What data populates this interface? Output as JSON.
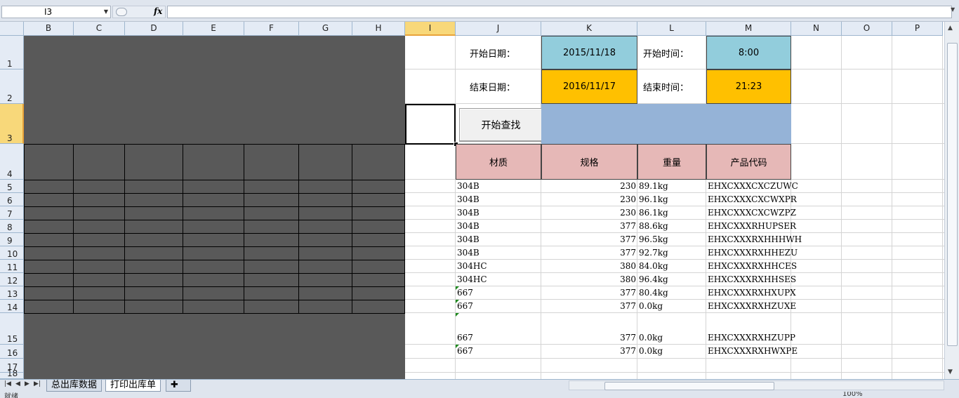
{
  "formula_bar": {
    "name_box": "I3",
    "fx": "fx",
    "formula": ""
  },
  "columns": [
    "B",
    "C",
    "D",
    "E",
    "F",
    "G",
    "H",
    "I",
    "J",
    "K",
    "L",
    "M",
    "N",
    "O",
    "P"
  ],
  "rows": [
    "1",
    "2",
    "3",
    "4",
    "5",
    "6",
    "7",
    "8",
    "9",
    "10",
    "11",
    "12",
    "13",
    "14",
    "15",
    "16",
    "17",
    "18"
  ],
  "search_panel": {
    "start_date_label": "开始日期：",
    "start_date": "2015/11/18",
    "start_time_label": "开始时间：",
    "start_time": "8:00",
    "end_date_label": "结束日期：",
    "end_date": "2016/11/17",
    "end_time_label": "结束时间：",
    "end_time": "21:23",
    "search_button": "开始查找"
  },
  "table": {
    "headers": [
      "材质",
      "规格",
      "重量",
      "产品代码"
    ],
    "rows": [
      [
        "304B",
        "230",
        "89.1kg",
        "EHXCXXXCXCZUWC"
      ],
      [
        "304B",
        "230",
        "96.1kg",
        "EHXCXXXCXCWXPR"
      ],
      [
        "304B",
        "230",
        "86.1kg",
        "EHXCXXXCXCWZPZ"
      ],
      [
        "304B",
        "377",
        "88.6kg",
        "EHXCXXXRHUPSER"
      ],
      [
        "304B",
        "377",
        "96.5kg",
        "EHXCXXXRXHHHWH"
      ],
      [
        "304B",
        "377",
        "92.7kg",
        "EHXCXXXRXHHEZU"
      ],
      [
        "304HC",
        "380",
        "84.0kg",
        "EHXCXXXRXHHCES"
      ],
      [
        "304HC",
        "380",
        "96.4kg",
        "EHXCXXXRXHHSES"
      ],
      [
        "667",
        "377",
        "80.4kg",
        "EHXCXXXRXHXUPX"
      ],
      [
        "667",
        "377",
        "0.0kg",
        "EHXCXXXRXHZUXE"
      ],
      [
        "667",
        "377",
        "0.0kg",
        "EHXCXXXRXHZUPP"
      ],
      [
        "667",
        "377",
        "0.0kg",
        "EHXCXXXRXHWXPE"
      ]
    ]
  },
  "sheet_tabs": [
    "总出库数据",
    "打印出库单"
  ],
  "status": {
    "ready": "就绪",
    "zoom": "100%"
  },
  "colors": {
    "blue_cell": "#92cddc",
    "orange_cell": "#ffc000",
    "steel_band": "#95b3d7",
    "header_pink": "#e6b8b7",
    "dark_block": "#595959"
  }
}
